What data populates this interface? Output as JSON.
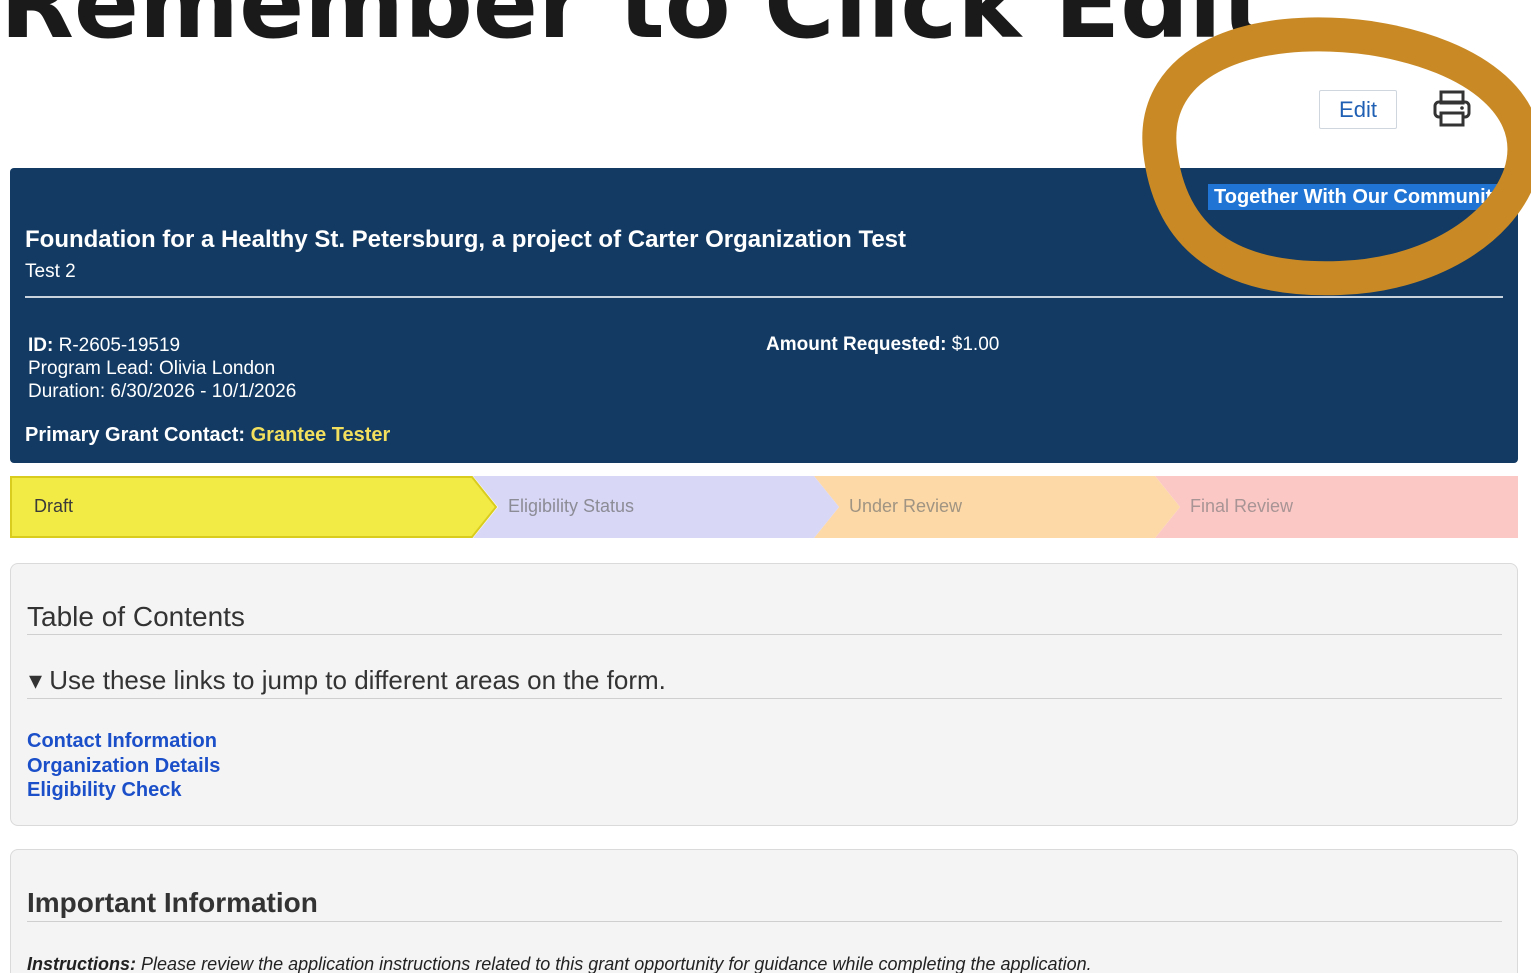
{
  "tutorial": {
    "heading": "Remember to Click Edit"
  },
  "toolbar": {
    "edit_label": "Edit",
    "print_icon": "printer-icon"
  },
  "header": {
    "tagline": "Together With Our Community",
    "org_title": "Foundation for a Healthy St. Petersburg, a project of Carter Organization Test",
    "subtitle": "Test 2",
    "id_label": "ID:",
    "id_value": "R-2605-19519",
    "program_lead": "Program Lead: Olivia London",
    "duration": "Duration: 6/30/2026 - 10/1/2026",
    "amount_label": "Amount Requested:",
    "amount_value": "$1.00",
    "contact_label": "Primary Grant Contact:",
    "contact_name": "Grantee Tester"
  },
  "stages": [
    {
      "label": "Draft",
      "active": true,
      "color": "#f2ea45",
      "text_color": "#3a3a3a"
    },
    {
      "label": "Eligibility Status",
      "active": false,
      "color": "#d8d7f6",
      "text_color": "#8c8c96"
    },
    {
      "label": "Under Review",
      "active": false,
      "color": "#fdd9a8",
      "text_color": "#a09482"
    },
    {
      "label": "Final Review",
      "active": false,
      "color": "#fbc8c6",
      "text_color": "#a89494"
    }
  ],
  "toc": {
    "title": "Table of Contents",
    "summary": "▾ Use these links to jump to different areas on the form.",
    "links": [
      "Contact Information",
      "Organization Details",
      "Eligibility Check"
    ]
  },
  "important": {
    "title": "Important Information",
    "instructions_label": "Instructions:",
    "instructions_text": "Please review the application instructions related to this grant opportunity for guidance while completing the application."
  },
  "colors": {
    "header_bg": "#123a63",
    "annotation": "#c98a25",
    "link": "#1a4fc9",
    "contact_highlight": "#f1df5d"
  }
}
